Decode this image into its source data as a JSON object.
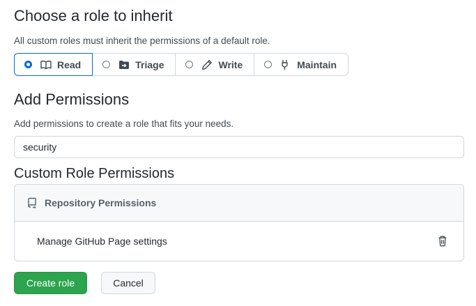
{
  "inherit": {
    "title": "Choose a role to inherit",
    "description": "All custom roles must inherit the permissions of a default role.",
    "roles": [
      {
        "label": "Read",
        "icon": "book-icon",
        "selected": true
      },
      {
        "label": "Triage",
        "icon": "folder-arrow-icon",
        "selected": false
      },
      {
        "label": "Write",
        "icon": "pencil-icon",
        "selected": false
      },
      {
        "label": "Maintain",
        "icon": "tools-icon",
        "selected": false
      }
    ]
  },
  "add": {
    "title": "Add Permissions",
    "description": "Add permissions to create a role that fits your needs.",
    "search_value": "security"
  },
  "custom": {
    "title": "Custom Role Permissions",
    "group_label": "Repository Permissions",
    "group_icon": "repo-icon",
    "items": [
      {
        "label": "Manage GitHub Page settings"
      }
    ]
  },
  "actions": {
    "create_label": "Create role",
    "cancel_label": "Cancel"
  },
  "colors": {
    "accent": "#0969da",
    "primary_button": "#2da44e"
  }
}
